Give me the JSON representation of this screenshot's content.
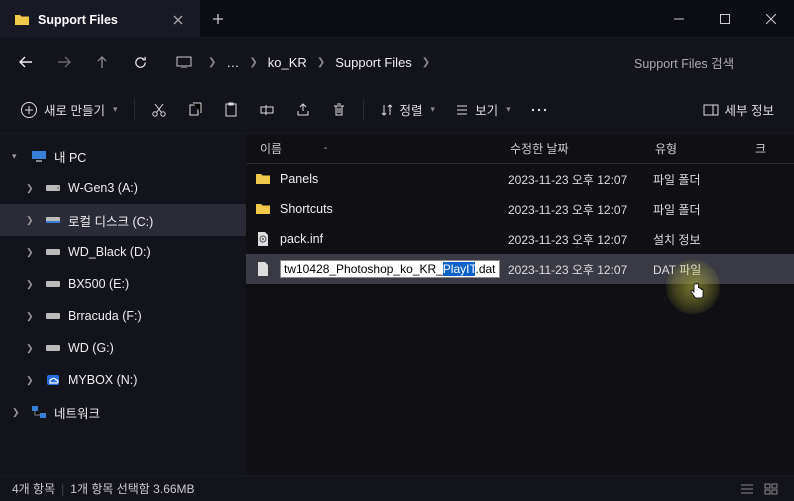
{
  "tab": {
    "title": "Support Files"
  },
  "breadcrumb": {
    "ellipsis": "…",
    "seg1": "ko_KR",
    "seg2": "Support Files"
  },
  "search": {
    "placeholder": "Support Files 검색"
  },
  "toolbar": {
    "new_label": "새로 만들기",
    "sort_label": "정렬",
    "view_label": "보기",
    "details_label": "세부 정보"
  },
  "sidebar": {
    "mypc": "내 PC",
    "items": [
      {
        "label": "W-Gen3 (A:)"
      },
      {
        "label": "로컬 디스크 (C:)"
      },
      {
        "label": "WD_Black (D:)"
      },
      {
        "label": "BX500 (E:)"
      },
      {
        "label": "Brracuda (F:)"
      },
      {
        "label": "WD (G:)"
      },
      {
        "label": "MYBOX (N:)"
      }
    ],
    "network": "네트워크"
  },
  "columns": {
    "name": "이름",
    "date": "수정한 날짜",
    "type": "유형",
    "size": "크"
  },
  "files": [
    {
      "name": "Panels",
      "date": "2023-11-23 오후 12:07",
      "type": "파일 폴더"
    },
    {
      "name": "Shortcuts",
      "date": "2023-11-23 오후 12:07",
      "type": "파일 폴더"
    },
    {
      "name": "pack.inf",
      "date": "2023-11-23 오후 12:07",
      "type": "설치 정보"
    },
    {
      "name_pre": "tw10428_Photoshop_ko_KR_",
      "name_sel": "PlayIT",
      "name_post": ".dat",
      "date": "2023-11-23 오후 12:07",
      "type": "DAT 파일"
    }
  ],
  "status": {
    "count": "4개 항목",
    "selected": "1개 항목 선택함 3.66MB"
  }
}
